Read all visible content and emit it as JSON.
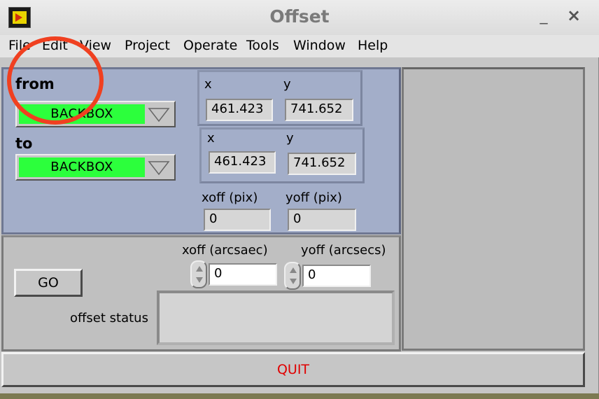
{
  "window": {
    "title": "Offset"
  },
  "titlebar": {
    "minimize": "_",
    "close": "×"
  },
  "menu": [
    "File",
    "Edit",
    "View",
    "Project",
    "Operate",
    "Tools",
    "Window",
    "Help"
  ],
  "from": {
    "label": "from",
    "selected": "BACKBOX",
    "x_label": "x",
    "y_label": "y",
    "x": "461.423",
    "y": "741.652"
  },
  "to": {
    "label": "to",
    "selected": "BACKBOX",
    "x_label": "x",
    "y_label": "y",
    "x": "461.423",
    "y": "741.652"
  },
  "offset_pix": {
    "xoff_label": "xoff (pix)",
    "yoff_label": "yoff (pix)",
    "xoff": "0",
    "yoff": "0"
  },
  "offset_arcsec": {
    "xoff_label": "xoff (arcsaec)",
    "yoff_label": "yoff (arcsecs)",
    "xoff": "0",
    "yoff": "0"
  },
  "go_label": "GO",
  "status": {
    "label": "offset status",
    "value": ""
  },
  "quit_label": "QUIT",
  "colors": {
    "ring_value": "#2cff3c",
    "quit_text": "#e00000",
    "panel_top": "#a3aec9",
    "annotation": "#f04020"
  }
}
